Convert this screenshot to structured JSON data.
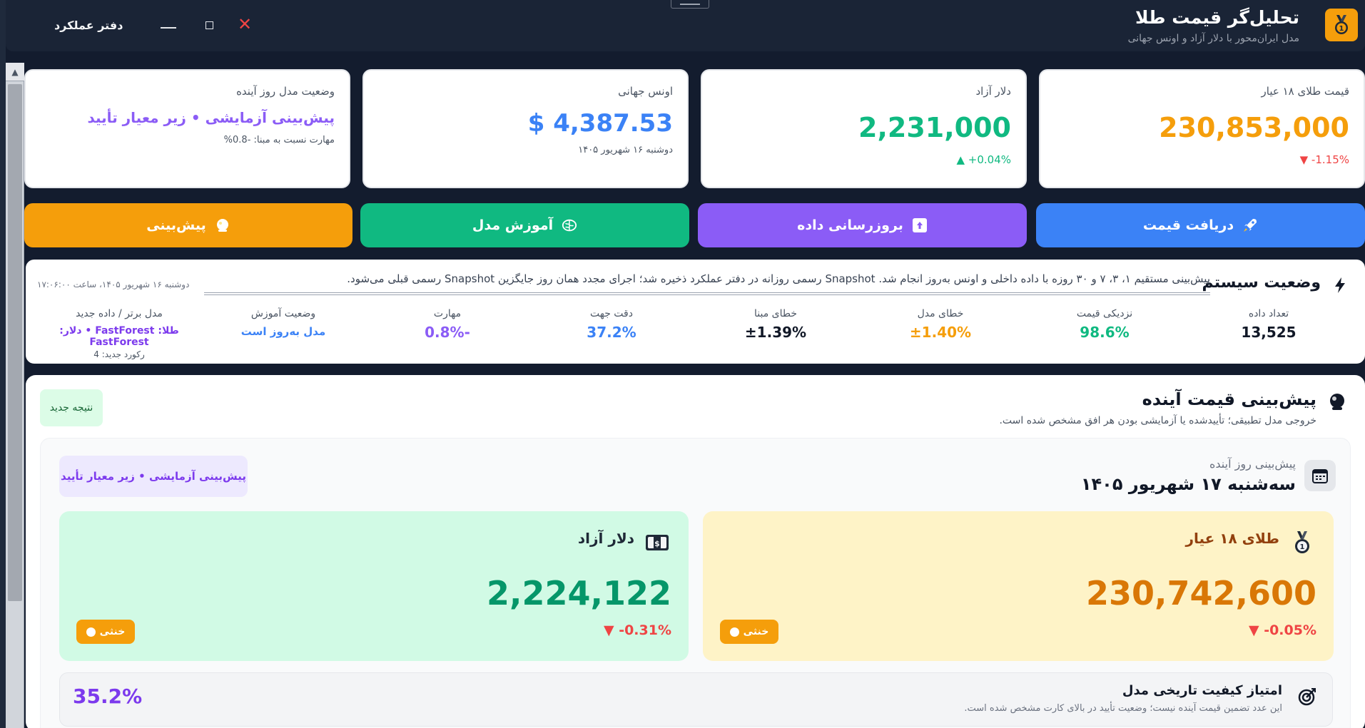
{
  "window": {
    "title": "تحلیل‌گر قیمت طلا",
    "subtitle": "مدل ایران‌محور با دلار آزاد و اونس جهانی",
    "performance_log": "دفتر عملکرد",
    "close_glyph": "✕"
  },
  "stats": {
    "gold": {
      "label": "قیمت طلای ۱۸ عیار",
      "value": "230,853,000",
      "change": "▼ -1.15%",
      "color": "#f59e0b"
    },
    "dollar": {
      "label": "دلار آزاد",
      "value": "2,231,000",
      "change": "▲ +0.04%",
      "color": "#10b981"
    },
    "ounce": {
      "label": "اونس جهانی",
      "value": "$ 4,387.53",
      "date": "دوشنبه ۱۶ شهریور ۱۴۰۵",
      "color": "#3b82f6"
    },
    "model": {
      "label": "وضعیت مدل روز آینده",
      "value": "پیش‌بینی آزمایشی • زیر معیار تأیید",
      "skill": "مهارت نسبت به مبنا: -0.8%",
      "color": "#8b5cf6"
    }
  },
  "actions": {
    "fetch_price": "دریافت قیمت",
    "update_data": "بروزرسانی داده",
    "train_model": "آموزش مدل",
    "predict": "پیش‌بینی"
  },
  "system_status": {
    "title": "وضعیت سیستم",
    "message": "پیش‌بینی مستقیم ۱، ۳، ۷ و ۳۰ روزه با داده داخلی و اونس به‌روز انجام شد. Snapshot رسمی روزانه در دفتر عملکرد ذخیره شد؛ اجرای مجدد همان روز جایگزین Snapshot رسمی قبلی می‌شود.",
    "timestamp": "دوشنبه ۱۶ شهریور ۱۴۰۵، ساعت ۱۷:۰۶:۰۰",
    "metrics": [
      {
        "label": "تعداد داده",
        "value": "13,525",
        "color": "#111827"
      },
      {
        "label": "نزدیکی قیمت",
        "value": "98.6%",
        "color": "#10b981"
      },
      {
        "label": "خطای مدل",
        "value": "±1.40%",
        "color": "#f59e0b"
      },
      {
        "label": "خطای مبنا",
        "value": "±1.39%",
        "color": "#111827"
      },
      {
        "label": "دقت جهت",
        "value": "37.2%",
        "color": "#3b82f6"
      },
      {
        "label": "مهارت",
        "value": "-0.8%",
        "color": "#8b5cf6"
      },
      {
        "label": "وضعیت آموزش",
        "value": "مدل به‌روز است",
        "color": "#3b82f6"
      },
      {
        "label": "مدل برتر / داده جدید",
        "value": "طلا: FastForest • دلار: FastForest",
        "extra": "رکورد جدید: 4",
        "color": "#7c3aed"
      }
    ]
  },
  "forecast": {
    "title": "پیش‌بینی قیمت آینده",
    "subtitle": "خروجی مدل تطبیقی؛ تأییدشده یا آزمایشی بودن هر افق مشخص شده است.",
    "new_result": "نتیجه جدید",
    "next_day_label": "پیش‌بینی روز آینده",
    "next_day_date": "سه‌شنبه ۱۷ شهریور ۱۴۰۵",
    "experimental_badge": "پیش‌بینی آزمایشی • زیر معیار تأیید",
    "gold": {
      "title": "طلای ۱۸ عیار",
      "value": "230,742,600",
      "change": "▼ -0.05%",
      "trend": "خنثی"
    },
    "dollar": {
      "title": "دلار آزاد",
      "value": "2,224,122",
      "change": "▼ -0.31%",
      "trend": "خنثی"
    },
    "quality": {
      "title": "امتیاز کیفیت تاریخی مدل",
      "description": "این عدد تضمین قیمت آینده نیست؛ وضعیت تأیید در بالای کارت مشخص شده است.",
      "value": "35.2%"
    }
  }
}
